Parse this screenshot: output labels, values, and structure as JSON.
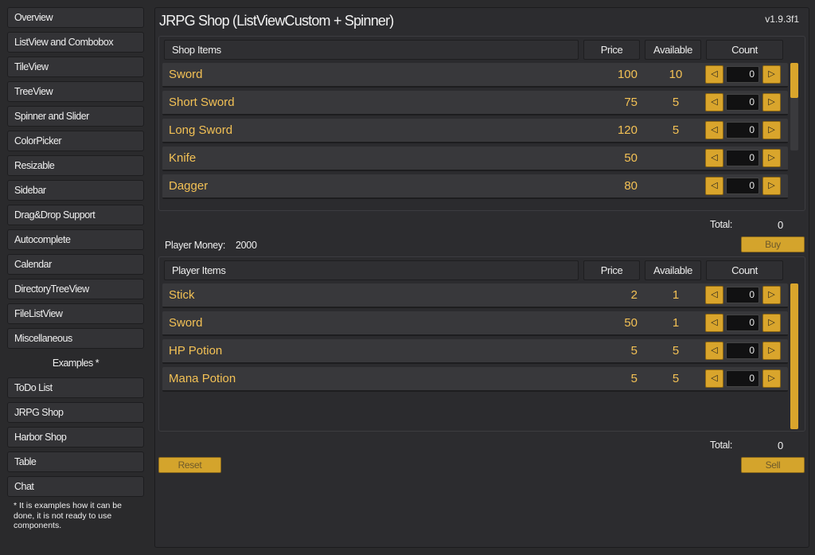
{
  "sidebar": {
    "items": [
      {
        "label": "Overview"
      },
      {
        "label": "ListView and Combobox"
      },
      {
        "label": "TileView"
      },
      {
        "label": "TreeView"
      },
      {
        "label": "Spinner and Slider"
      },
      {
        "label": "ColorPicker"
      },
      {
        "label": "Resizable"
      },
      {
        "label": "Sidebar"
      },
      {
        "label": "Drag&Drop Support"
      },
      {
        "label": "Autocomplete"
      },
      {
        "label": "Calendar"
      },
      {
        "label": "DirectoryTreeView"
      },
      {
        "label": "FileListView"
      },
      {
        "label": "Miscellaneous"
      }
    ],
    "examples_header": "Examples *",
    "examples": [
      {
        "label": "ToDo List"
      },
      {
        "label": "JRPG Shop"
      },
      {
        "label": "Harbor Shop"
      },
      {
        "label": "Table"
      },
      {
        "label": "Chat"
      }
    ],
    "footnote": "* It is examples how it can be done, it is not ready to use components."
  },
  "main": {
    "title": "JRPG Shop (ListViewCustom + Spinner)",
    "version": "v1.9.3f1"
  },
  "shop": {
    "headers": {
      "name": "Shop Items",
      "price": "Price",
      "available": "Available",
      "count": "Count"
    },
    "rows": [
      {
        "name": "Sword",
        "price": "100",
        "available": "10",
        "count": "0"
      },
      {
        "name": "Short Sword",
        "price": "75",
        "available": "5",
        "count": "0"
      },
      {
        "name": "Long Sword",
        "price": "120",
        "available": "5",
        "count": "0"
      },
      {
        "name": "Knife",
        "price": "50",
        "available": "",
        "count": "0"
      },
      {
        "name": "Dagger",
        "price": "80",
        "available": "",
        "count": "0"
      }
    ],
    "total_label": "Total:",
    "total_value": "0",
    "buy_label": "Buy",
    "scroll_fraction": 0.4
  },
  "player": {
    "money_label": "Player Money:",
    "money_value": "2000",
    "headers": {
      "name": "Player Items",
      "price": "Price",
      "available": "Available",
      "count": "Count"
    },
    "rows": [
      {
        "name": "Stick",
        "price": "2",
        "available": "1",
        "count": "0"
      },
      {
        "name": "Sword",
        "price": "50",
        "available": "1",
        "count": "0"
      },
      {
        "name": "HP Potion",
        "price": "5",
        "available": "5",
        "count": "0"
      },
      {
        "name": "Mana Potion",
        "price": "5",
        "available": "5",
        "count": "0"
      }
    ],
    "total_label": "Total:",
    "total_value": "0",
    "sell_label": "Sell",
    "reset_label": "Reset",
    "scroll_fraction": 1.0
  },
  "icons": {
    "decrement": "triangle-left-icon",
    "increment": "triangle-right-icon"
  },
  "colors": {
    "accent": "#d9a52c",
    "item_text": "#f3c155",
    "background": "#2a2a2c"
  }
}
